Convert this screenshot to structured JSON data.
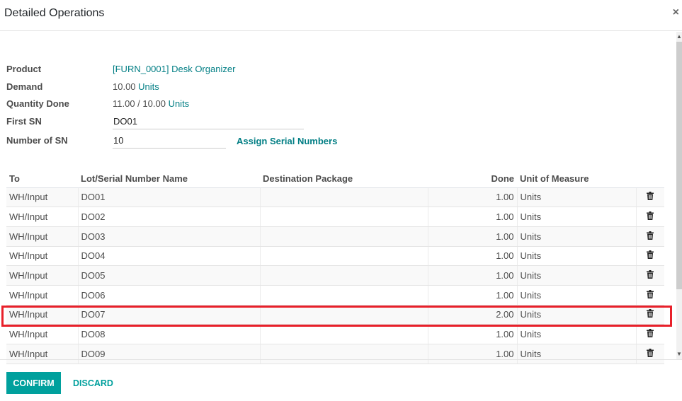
{
  "modal": {
    "title": "Detailed Operations",
    "close_icon": "close-icon"
  },
  "form": {
    "product_label": "Product",
    "product_value": "[FURN_0001] Desk Organizer",
    "demand_label": "Demand",
    "demand_value": "10.00",
    "demand_uom": "Units",
    "qty_done_label": "Quantity Done",
    "qty_done_value": "11.00 / 10.00",
    "qty_done_uom": "Units",
    "first_sn_label": "First SN",
    "first_sn_value": "DO01",
    "number_sn_label": "Number of SN",
    "number_sn_value": "10",
    "assign_button": "Assign Serial Numbers"
  },
  "table": {
    "headers": {
      "to": "To",
      "lot": "Lot/Serial Number Name",
      "package": "Destination Package",
      "done": "Done",
      "uom": "Unit of Measure"
    },
    "rows": [
      {
        "to": "WH/Input",
        "lot": "DO01",
        "package": "",
        "done": "1.00",
        "uom": "Units"
      },
      {
        "to": "WH/Input",
        "lot": "DO02",
        "package": "",
        "done": "1.00",
        "uom": "Units"
      },
      {
        "to": "WH/Input",
        "lot": "DO03",
        "package": "",
        "done": "1.00",
        "uom": "Units"
      },
      {
        "to": "WH/Input",
        "lot": "DO04",
        "package": "",
        "done": "1.00",
        "uom": "Units"
      },
      {
        "to": "WH/Input",
        "lot": "DO05",
        "package": "",
        "done": "1.00",
        "uom": "Units"
      },
      {
        "to": "WH/Input",
        "lot": "DO06",
        "package": "",
        "done": "1.00",
        "uom": "Units"
      },
      {
        "to": "WH/Input",
        "lot": "DO07",
        "package": "",
        "done": "2.00",
        "uom": "Units"
      },
      {
        "to": "WH/Input",
        "lot": "DO08",
        "package": "",
        "done": "1.00",
        "uom": "Units"
      },
      {
        "to": "WH/Input",
        "lot": "DO09",
        "package": "",
        "done": "1.00",
        "uom": "Units"
      }
    ],
    "highlighted_row_index": 6,
    "delete_icon": "trash-icon"
  },
  "footer": {
    "confirm_label": "CONFIRM",
    "discard_label": "DISCARD"
  },
  "colors": {
    "accent": "#00a09d",
    "link": "#017e84",
    "highlight": "#e8202a"
  }
}
